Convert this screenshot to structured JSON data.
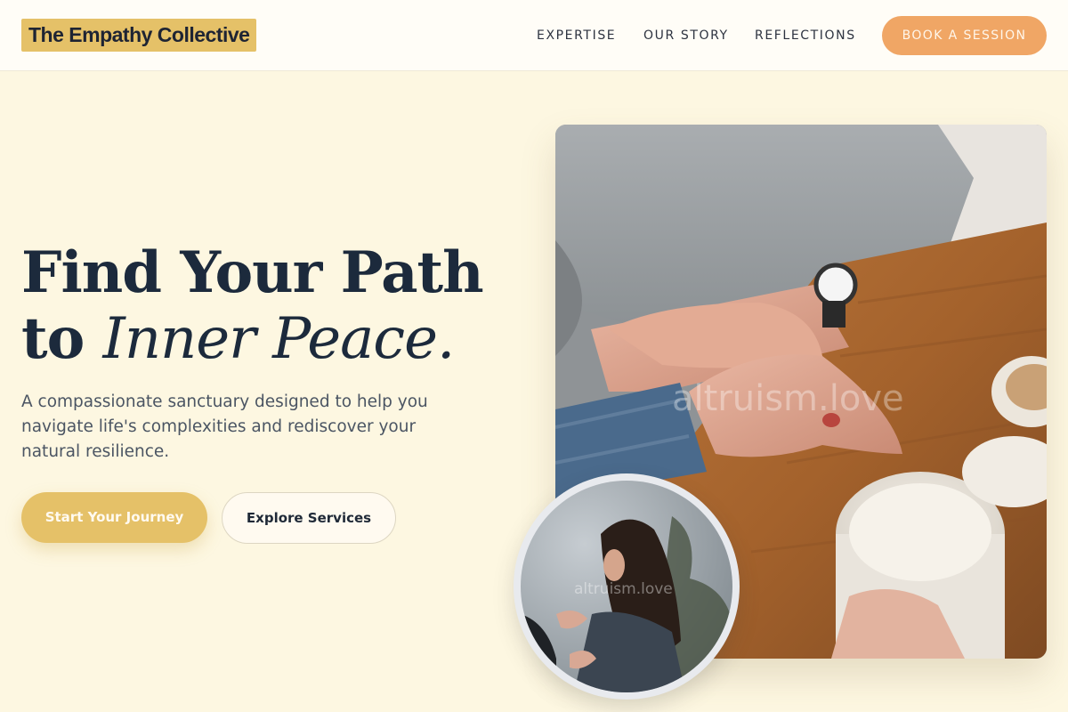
{
  "nav": {
    "logo": "The Empathy Collective",
    "links": [
      {
        "label": "EXPERTISE"
      },
      {
        "label": "OUR STORY"
      },
      {
        "label": "REFLECTIONS"
      }
    ],
    "cta": "BOOK A SESSION"
  },
  "hero": {
    "headline_line1": "Find Your Path",
    "headline_to": "to ",
    "headline_emphasis": "Inner Peace.",
    "description": "A compassionate sanctuary designed to help you navigate life's complexities and rediscover your natural resilience.",
    "primary_button": "Start Your Journey",
    "secondary_button": "Explore Services"
  },
  "images": {
    "main_watermark": "altruism.love",
    "circle_watermark": "altruism.love"
  },
  "colors": {
    "page_background": "#fdf7e1",
    "accent_gold": "#e5c168",
    "accent_orange": "#f0a665",
    "heading": "#1c2a3c"
  }
}
